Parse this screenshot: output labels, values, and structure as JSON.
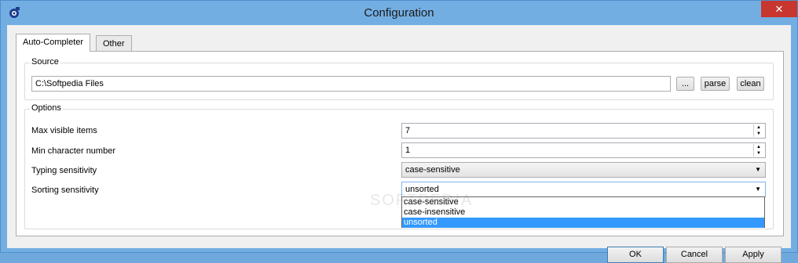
{
  "window": {
    "title": "Configuration",
    "close_glyph": "✕"
  },
  "tabs": [
    {
      "label": "Auto-Completer",
      "active": true
    },
    {
      "label": "Other",
      "active": false
    }
  ],
  "source": {
    "group_label": "Source",
    "path_value": "C:\\Softpedia Files",
    "browse_label": "...",
    "parse_label": "parse",
    "clean_label": "clean"
  },
  "options": {
    "group_label": "Options",
    "max_visible": {
      "label": "Max visible items",
      "value": "7"
    },
    "min_chars": {
      "label": "Min character number",
      "value": "1"
    },
    "typing": {
      "label": "Typing sensitivity",
      "value": "case-sensitive"
    },
    "sorting": {
      "label": "Sorting sensitivity",
      "value": "unsorted",
      "options": [
        "case-sensitive",
        "case-insensitive",
        "unsorted"
      ]
    }
  },
  "footer": {
    "ok_label": "OK",
    "cancel_label": "Cancel",
    "apply_label": "Apply"
  },
  "watermark": "SOFTPEDIA",
  "colors": {
    "title_bar": "#73aee3",
    "close_button": "#c7372f",
    "selection": "#3399ff"
  }
}
